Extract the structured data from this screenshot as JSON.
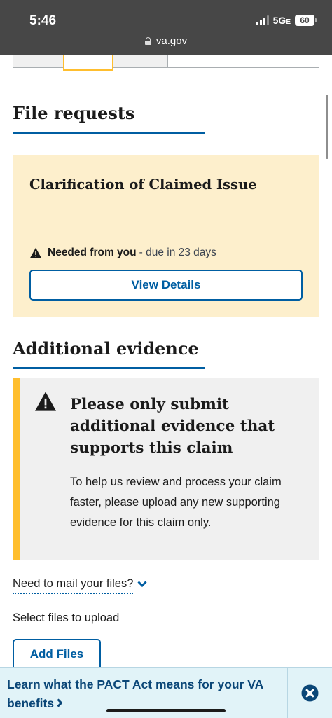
{
  "status_bar": {
    "time": "5:46",
    "network": "5G",
    "network_suffix": "E",
    "battery": "60"
  },
  "browser": {
    "url": "va.gov"
  },
  "file_requests": {
    "heading": "File requests",
    "card": {
      "title": "Clarification of Claimed Issue",
      "status_strong": "Needed from you",
      "status_due": "- due in 23 days",
      "button_label": "View Details"
    }
  },
  "additional_evidence": {
    "heading": "Additional evidence",
    "alert": {
      "title": "Please only submit additional evidence that supports this claim",
      "body": "To help us review and process your claim faster, please upload any new supporting evidence for this claim only."
    },
    "mail_link": "Need to mail your files?",
    "select_label": "Select files to upload",
    "add_button": "Add Files"
  },
  "banner": {
    "text": "Learn what the PACT Act means for your VA benefits"
  },
  "colors": {
    "primary": "#005ea2",
    "warning_bg": "#fdefcc",
    "alert_border": "#ffbe2e",
    "banner_bg": "#e1f3f8"
  },
  "icons": {
    "warning": "warning-icon",
    "chevron": "chevron-down-icon",
    "close": "close-circle-icon",
    "lock": "lock-icon"
  }
}
